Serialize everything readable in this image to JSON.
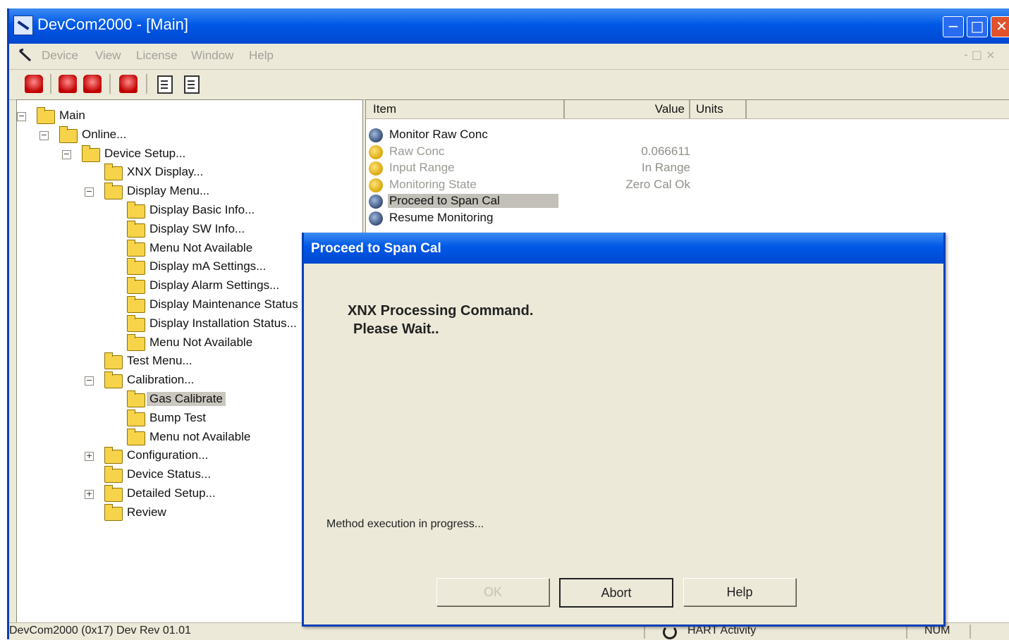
{
  "window": {
    "title": "DevCom2000 - [Main]",
    "min_glyph": "−",
    "max_glyph": "□",
    "close_glyph": "✕"
  },
  "menu": [
    "Device",
    "View",
    "License",
    "Window",
    "Help"
  ],
  "menu_mdi_glyphs": "- □ ×",
  "tree": {
    "nodes": [
      {
        "label": "Main",
        "expander": "−"
      },
      {
        "label": "Online...",
        "expander": "−"
      },
      {
        "label": "Device Setup...",
        "expander": "−"
      },
      {
        "label": "XNX Display..."
      },
      {
        "label": "Display Menu...",
        "expander": "−"
      },
      {
        "label": "Display Basic Info..."
      },
      {
        "label": "Display SW Info..."
      },
      {
        "label": "Menu Not Available"
      },
      {
        "label": "Display mA Settings..."
      },
      {
        "label": "Display Alarm Settings..."
      },
      {
        "label": "Display Maintenance Status"
      },
      {
        "label": "Display Installation Status..."
      },
      {
        "label": "Menu Not Available"
      },
      {
        "label": "Test Menu..."
      },
      {
        "label": "Calibration...",
        "expander": "−"
      },
      {
        "label": "Gas Calibrate",
        "selected": true
      },
      {
        "label": "Bump Test"
      },
      {
        "label": "Menu not Available"
      },
      {
        "label": "Configuration...",
        "expander": "+"
      },
      {
        "label": "Device Status..."
      },
      {
        "label": "Detailed Setup...",
        "expander": "+"
      },
      {
        "label": "Review"
      }
    ]
  },
  "list": {
    "columns": [
      "Item",
      "Value",
      "Units"
    ],
    "rows": [
      {
        "item": "Monitor Raw Conc",
        "value": "",
        "icon": "method"
      },
      {
        "item": "Raw Conc",
        "value": "0.066611",
        "icon": "variable",
        "dim": true
      },
      {
        "item": "Input Range",
        "value": "In Range",
        "icon": "variable",
        "dim": true
      },
      {
        "item": "Monitoring State",
        "value": "Zero Cal Ok",
        "icon": "variable",
        "dim": true
      },
      {
        "item": "Proceed to Span Cal",
        "value": "",
        "icon": "method",
        "highlighted": true
      },
      {
        "item": "Resume Monitoring",
        "value": "",
        "icon": "method"
      }
    ]
  },
  "status": {
    "left": "DevCom2000  (0x17)  Dev Rev 01.01",
    "hart": "HART Activity",
    "mode": "NUM"
  },
  "dialog": {
    "title": "Proceed to Span Cal",
    "message_line1": "XNX Processing Command.",
    "message_line2": "Please Wait..",
    "status": "Method execution in progress...",
    "ok_label": "OK",
    "abort_label": "Abort",
    "help_label": "Help"
  }
}
